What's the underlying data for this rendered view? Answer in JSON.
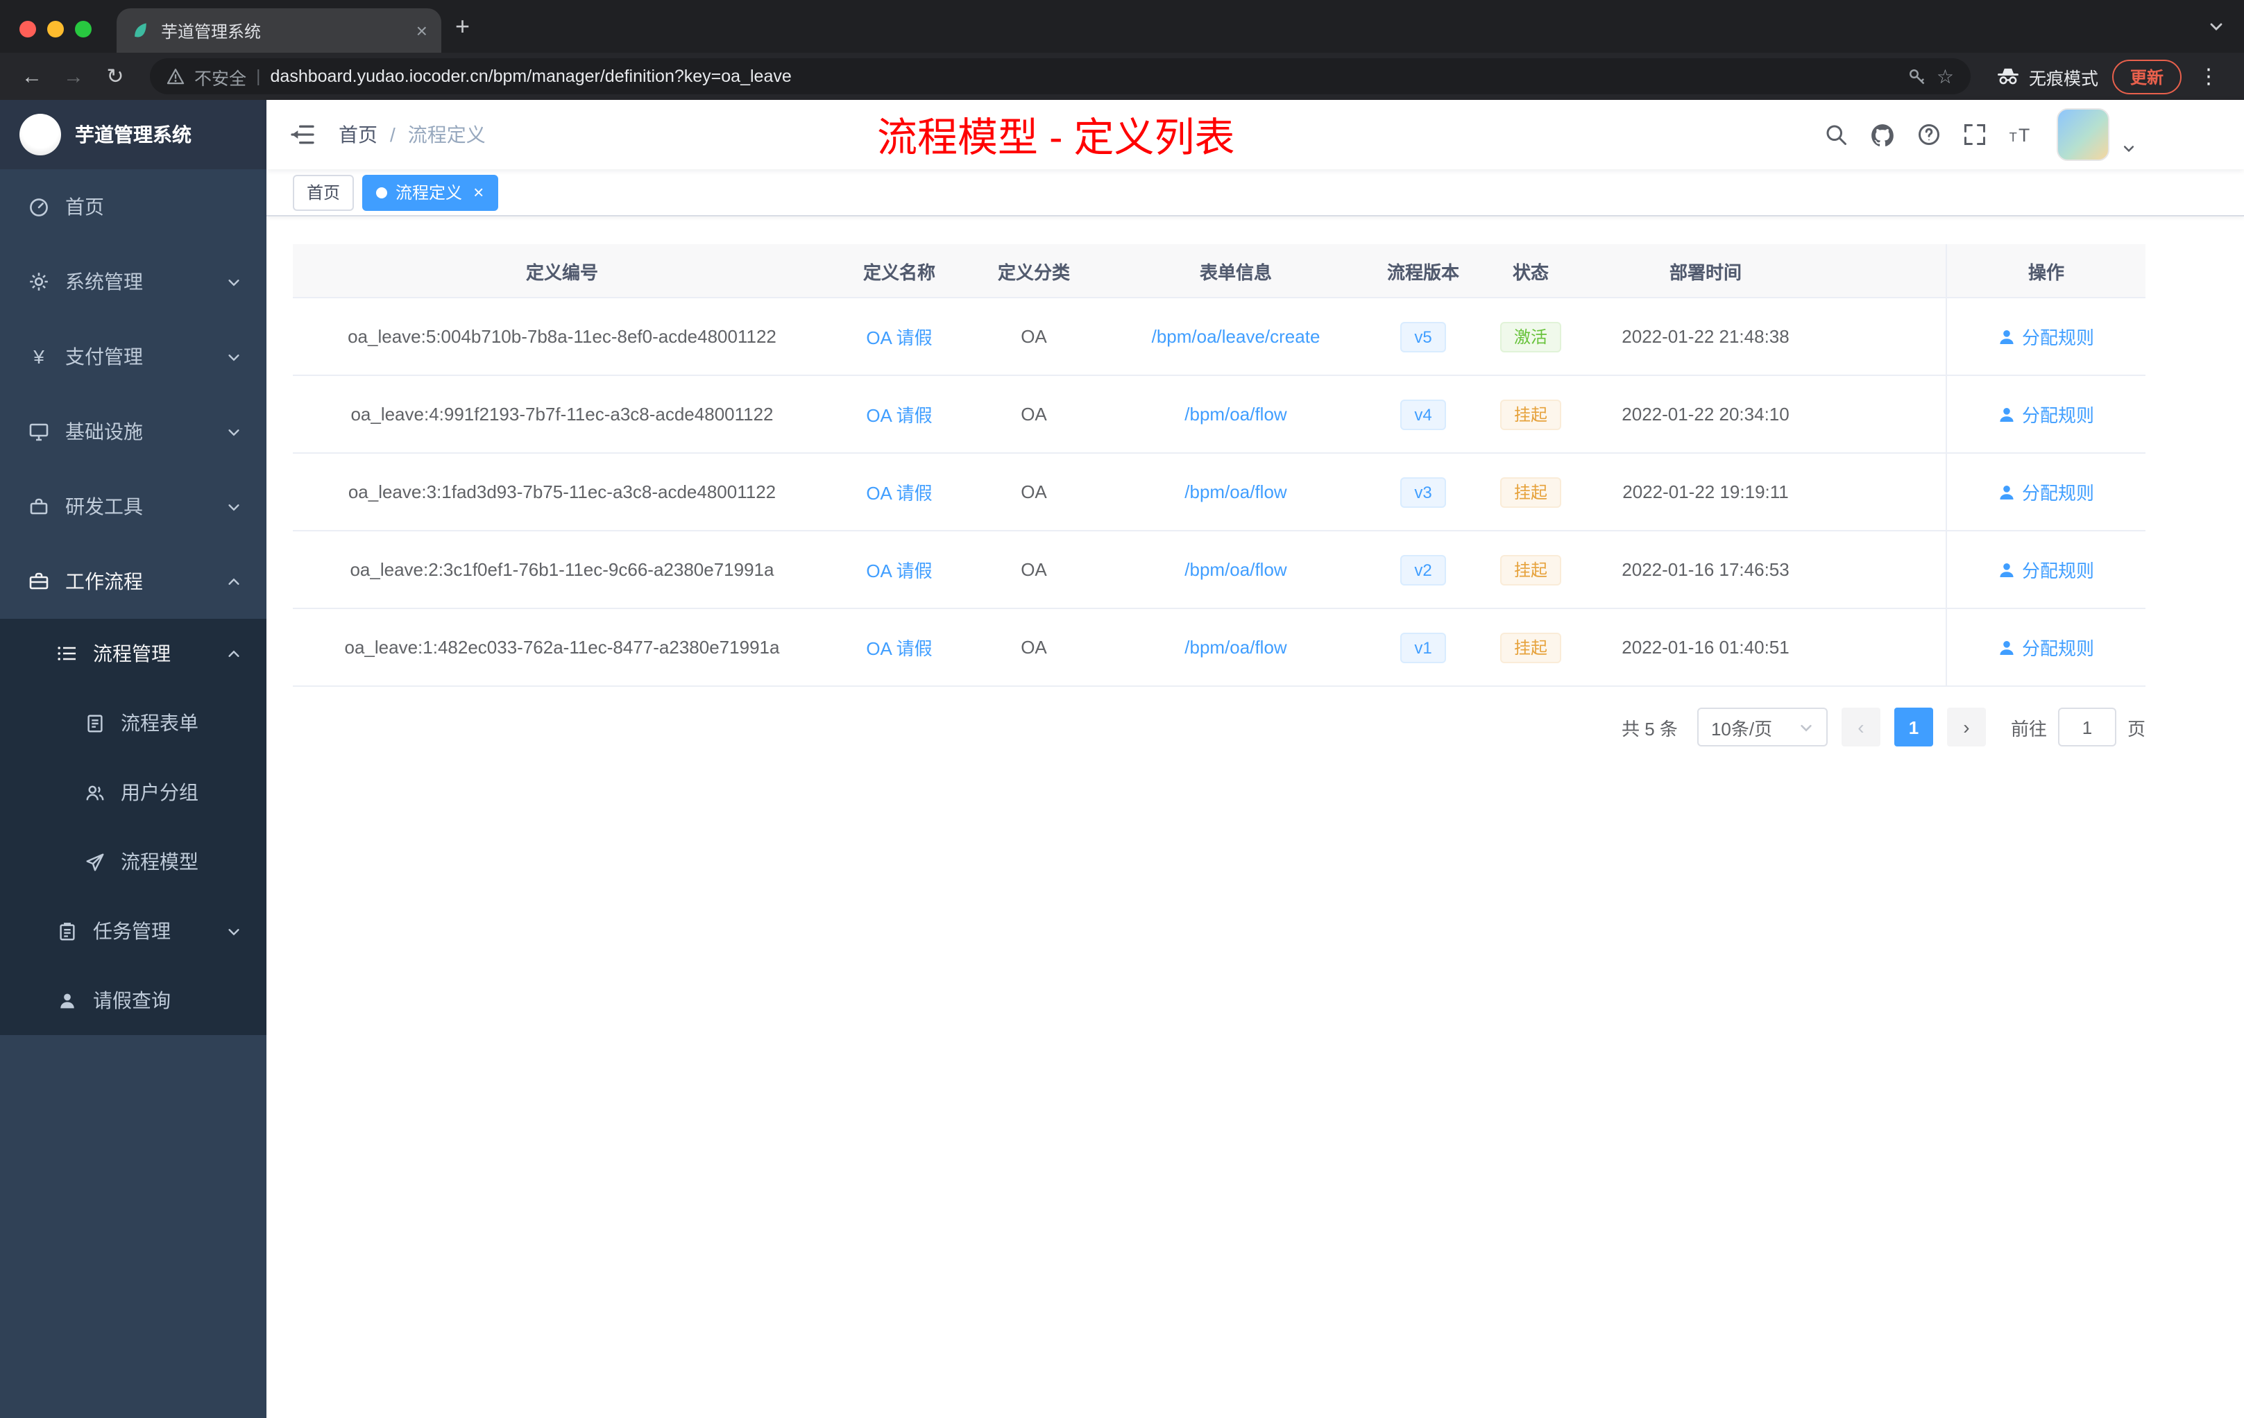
{
  "browser": {
    "tab_title": "芋道管理系统",
    "security_label": "不安全",
    "url": "dashboard.yudao.iocoder.cn/bpm/manager/definition?key=oa_leave",
    "incognito_label": "无痕模式",
    "update_label": "更新"
  },
  "glyphs": {
    "close": "×",
    "new_tab": "+",
    "back": "←",
    "forward": "→",
    "reload": "↻",
    "divider": "|",
    "star": "☆",
    "more": "⋮",
    "yen": "¥",
    "prev": "‹",
    "next": "›"
  },
  "sidebar": {
    "logo_title": "芋道管理系统",
    "menu": [
      {
        "label": "首页",
        "icon": "dashboard-icon"
      },
      {
        "label": "系统管理",
        "icon": "gear-icon"
      },
      {
        "label": "支付管理",
        "icon": "yen-icon"
      },
      {
        "label": "基础设施",
        "icon": "monitor-icon"
      },
      {
        "label": "研发工具",
        "icon": "toolbox-icon"
      },
      {
        "label": "工作流程",
        "icon": "briefcase-icon"
      }
    ],
    "submenu": [
      {
        "label": "流程管理",
        "icon": "list-icon"
      },
      {
        "label": "流程表单",
        "icon": "document-icon"
      },
      {
        "label": "用户分组",
        "icon": "users-icon"
      },
      {
        "label": "流程模型",
        "icon": "send-icon"
      },
      {
        "label": "任务管理",
        "icon": "clipboard-icon"
      },
      {
        "label": "请假查询",
        "icon": "user-icon"
      }
    ]
  },
  "navbar": {
    "breadcrumb_home": "首页",
    "breadcrumb_sep": "/",
    "breadcrumb_current": "流程定义",
    "annotation": "流程模型 - 定义列表"
  },
  "tags": {
    "home": "首页",
    "active": "流程定义"
  },
  "table": {
    "columns": {
      "id": "定义编号",
      "name": "定义名称",
      "category": "定义分类",
      "form": "表单信息",
      "version": "流程版本",
      "status": "状态",
      "time": "部署时间",
      "action": "操作"
    },
    "rows": [
      {
        "id": "oa_leave:5:004b710b-7b8a-11ec-8ef0-acde48001122",
        "name": "OA 请假",
        "category": "OA",
        "form": "/bpm/oa/leave/create",
        "version": "v5",
        "status": "激活",
        "time": "2022-01-22 21:48:38",
        "action": "分配规则"
      },
      {
        "id": "oa_leave:4:991f2193-7b7f-11ec-a3c8-acde48001122",
        "name": "OA 请假",
        "category": "OA",
        "form": "/bpm/oa/flow",
        "version": "v4",
        "status": "挂起",
        "time": "2022-01-22 20:34:10",
        "action": "分配规则"
      },
      {
        "id": "oa_leave:3:1fad3d93-7b75-11ec-a3c8-acde48001122",
        "name": "OA 请假",
        "category": "OA",
        "form": "/bpm/oa/flow",
        "version": "v3",
        "status": "挂起",
        "time": "2022-01-22 19:19:11",
        "action": "分配规则"
      },
      {
        "id": "oa_leave:2:3c1f0ef1-76b1-11ec-9c66-a2380e71991a",
        "name": "OA 请假",
        "category": "OA",
        "form": "/bpm/oa/flow",
        "version": "v2",
        "status": "挂起",
        "time": "2022-01-16 17:46:53",
        "action": "分配规则"
      },
      {
        "id": "oa_leave:1:482ec033-762a-11ec-8477-a2380e71991a",
        "name": "OA 请假",
        "category": "OA",
        "form": "/bpm/oa/flow",
        "version": "v1",
        "status": "挂起",
        "time": "2022-01-16 01:40:51",
        "action": "分配规则"
      }
    ]
  },
  "pagination": {
    "total": "共 5 条",
    "page_size": "10条/页",
    "page": "1",
    "goto_label": "前往",
    "goto_value": "1",
    "goto_unit": "页"
  },
  "colors": {
    "accent": "#409eff",
    "status_active": "#67c23a",
    "status_suspended": "#e6a23c",
    "annotation_red": "#ff0000",
    "sidebar_bg": "#304156",
    "submenu_bg": "#1f2d3d"
  }
}
